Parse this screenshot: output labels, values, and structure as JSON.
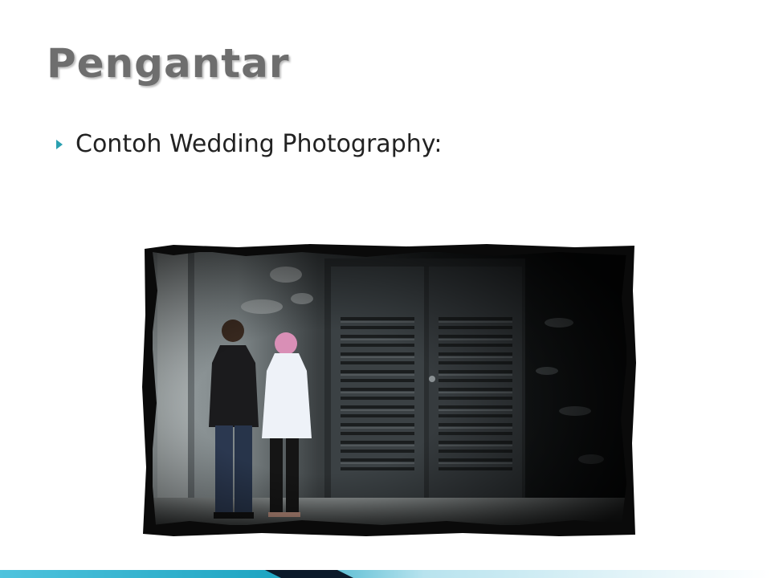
{
  "slide": {
    "title": "Pengantar",
    "bullets": [
      {
        "text": "Contoh Wedding Photography:"
      }
    ],
    "photo": {
      "subject": "wedding-couple-photo"
    },
    "colors": {
      "title": "#6e6e6e",
      "bullet_accent": "#2aa0b0",
      "footer_teal": "#1fa5c2",
      "footer_dark": "#0b1a2a"
    }
  }
}
